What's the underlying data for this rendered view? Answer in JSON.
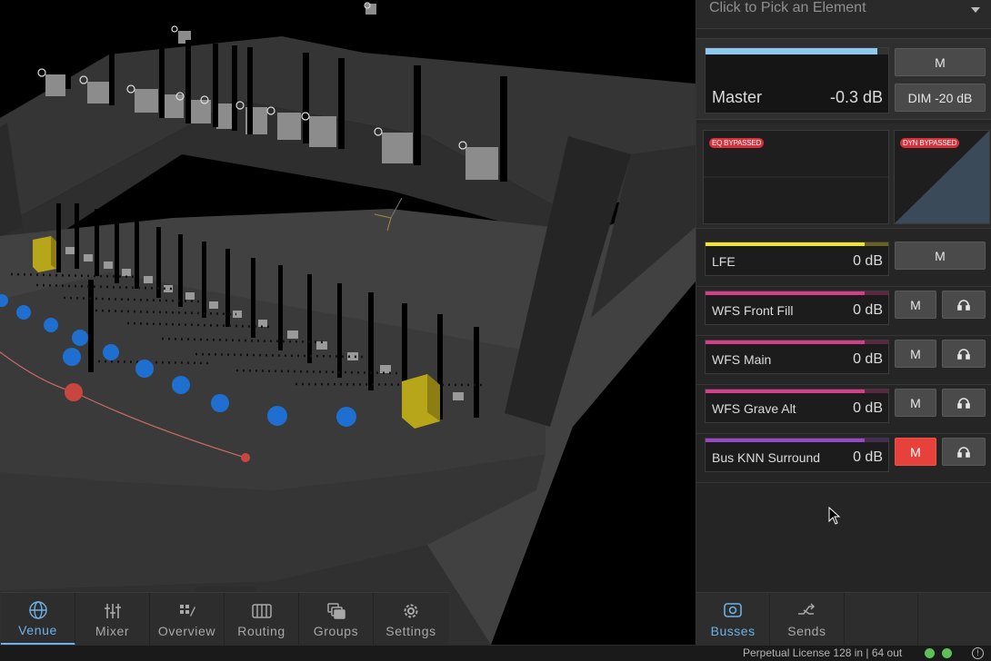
{
  "element_picker": {
    "placeholder": "Click to Pick an Element"
  },
  "master": {
    "name": "Master",
    "gain": "-0.3 dB",
    "level": 0.94,
    "meter_color": "#8ec8ef",
    "mute_label": "M",
    "dim_label": "DIM -20 dB"
  },
  "processing": {
    "eq_status": "EQ BYPASSED",
    "dyn_status": "DYN BYPASSED"
  },
  "busses": [
    {
      "name": "LFE",
      "gain": "0 dB",
      "level": 0.87,
      "color": "#f5e623",
      "mute_label": "M",
      "muted": false,
      "solo": false
    },
    {
      "name": "WFS Front Fill",
      "gain": "0 dB",
      "level": 0.87,
      "color": "#d63d8a",
      "mute_label": "M",
      "muted": false,
      "solo": true,
      "solo_icon": "headphones-icon"
    },
    {
      "name": "WFS Main",
      "gain": "0 dB",
      "level": 0.87,
      "color": "#d63d8a",
      "mute_label": "M",
      "muted": false,
      "solo": true,
      "solo_icon": "headphones-icon"
    },
    {
      "name": "WFS Grave Alt",
      "gain": "0 dB",
      "level": 0.87,
      "color": "#d63d8a",
      "mute_label": "M",
      "muted": false,
      "solo": true,
      "solo_icon": "headphones-icon"
    },
    {
      "name": "Bus KNN Surround",
      "gain": "0 dB",
      "level": 0.87,
      "color": "#9a48c9",
      "mute_label": "M",
      "muted": true,
      "solo": true,
      "solo_icon": "headphones-icon"
    }
  ],
  "nav": {
    "items": [
      {
        "label": "Venue",
        "icon": "globe-icon",
        "active": true
      },
      {
        "label": "Mixer",
        "icon": "sliders-icon",
        "active": false
      },
      {
        "label": "Overview",
        "icon": "overview-icon",
        "active": false
      },
      {
        "label": "Routing",
        "icon": "routing-icon",
        "active": false
      },
      {
        "label": "Groups",
        "icon": "groups-icon",
        "active": false
      },
      {
        "label": "Settings",
        "icon": "gear-icon",
        "active": false
      }
    ]
  },
  "panel_tabs": [
    {
      "label": "Busses",
      "icon": "speaker-icon",
      "active": true
    },
    {
      "label": "Sends",
      "icon": "sends-icon",
      "active": false
    }
  ],
  "status": {
    "license": "Perpetual License 128 in | 64 out",
    "indicators": [
      "#5fc05a",
      "#5fc05a"
    ]
  },
  "colors": {
    "accent": "#6fb1e6",
    "mute_active": "#e6423b",
    "source_blue": "#1f6fd1",
    "source_red": "#d9534f",
    "speaker_yellow": "#b8a61a"
  }
}
